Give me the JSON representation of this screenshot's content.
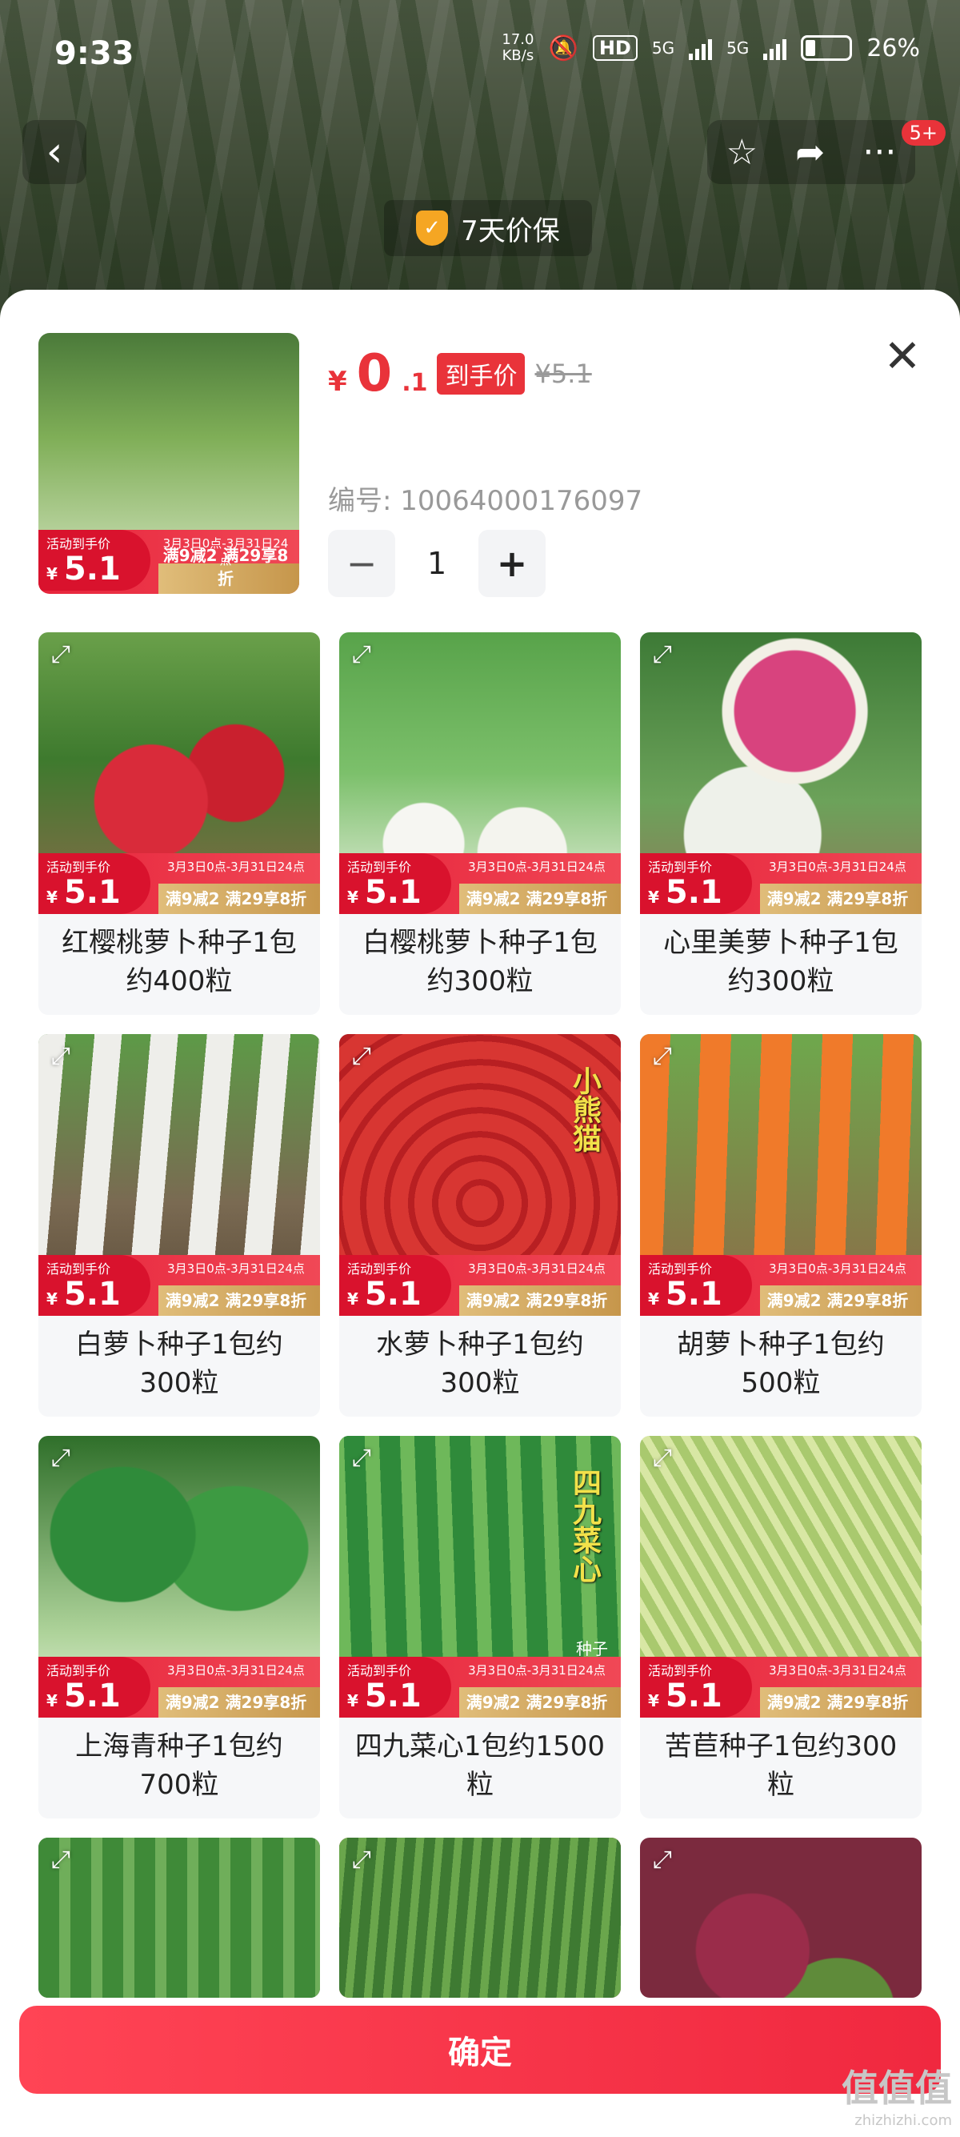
{
  "status_bar": {
    "time": "9:33",
    "net_speed": "17.0\nKB/s",
    "hd_label": "HD",
    "net_5g_a": "5G",
    "net_5g_b": "5G",
    "battery": "26%"
  },
  "header": {
    "back_icon": "chevron-left-icon",
    "favorite_icon": "star-icon",
    "share_icon": "share-icon",
    "more_icon": "more-icon",
    "more_badge": "5+",
    "price_guard": "7天价保"
  },
  "selected": {
    "currency": "¥",
    "price_int": "0",
    "price_dec": ".1",
    "price_tag": "到手价",
    "old_price": "¥5.1",
    "sku_code": "编号: 10064000176097",
    "quantity": "1",
    "minus": "−",
    "plus": "+"
  },
  "promo": {
    "label": "活动到手价",
    "currency": "¥",
    "price": "5.1",
    "date": "3月3日0点-3月31日24点",
    "deal": "满9减2 满29享8折"
  },
  "products": [
    {
      "title": "红樱桃萝卜种子1包约400粒",
      "img": "img-radish-red"
    },
    {
      "title": "白樱桃萝卜种子1包约300粒",
      "img": "img-radish-white"
    },
    {
      "title": "心里美萝卜种子1包约300粒",
      "img": "img-watermelon"
    },
    {
      "title": "白萝卜种子1包约300粒",
      "img": "img-daikon"
    },
    {
      "title": "水萝卜种子1包约300粒",
      "img": "img-water-radish",
      "overlay": "小熊猫"
    },
    {
      "title": "胡萝卜种子1包约500粒",
      "img": "img-carrot"
    },
    {
      "title": "上海青种子1包约700粒",
      "img": "img-bokchoy"
    },
    {
      "title": "四九菜心1包约1500粒",
      "img": "img-caixin",
      "overlay": "四九菜心",
      "overlay_sub": "种子"
    },
    {
      "title": "苦苣种子1包约300粒",
      "img": "img-endive"
    },
    {
      "title": "",
      "img": "img-bitter"
    },
    {
      "title": "",
      "img": "img-chive",
      "selected": true
    },
    {
      "title": "",
      "img": "img-amaranth"
    }
  ],
  "confirm_label": "确定",
  "watermark": {
    "main": "值值值",
    "sub": "zhizhizhi.com"
  },
  "colors": {
    "accent": "#e9333a",
    "confirm_start": "#ff4455",
    "confirm_end": "#f0283f"
  }
}
